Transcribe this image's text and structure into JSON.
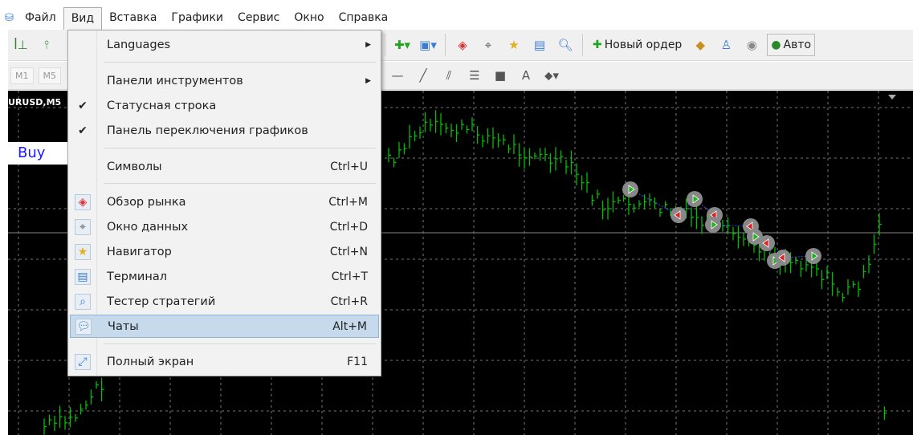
{
  "menubar": {
    "items": [
      "Файл",
      "Вид",
      "Вставка",
      "Графики",
      "Сервис",
      "Окно",
      "Справка"
    ],
    "open": "Вид"
  },
  "toolbar": {
    "new_order": "Новый ордер",
    "auto": "Авто",
    "timeframes": [
      "M1",
      "M5"
    ]
  },
  "chart": {
    "symbol": "URUSD,M5",
    "buy_label": "Buy"
  },
  "view_menu": {
    "items": [
      {
        "label": "Languages",
        "submenu": true
      },
      {
        "label": "Панели инструментов",
        "submenu": true
      },
      {
        "label": "Статусная строка",
        "checked": true
      },
      {
        "label": "Панель переключения графиков",
        "checked": true
      },
      {
        "label": "Символы",
        "shortcut": "Ctrl+U"
      },
      {
        "label": "Обзор рынка",
        "shortcut": "Ctrl+M",
        "icon": "market-watch-icon"
      },
      {
        "label": "Окно данных",
        "shortcut": "Ctrl+D",
        "icon": "crosshair-icon"
      },
      {
        "label": "Навигатор",
        "shortcut": "Ctrl+N",
        "icon": "navigator-folder-star-icon"
      },
      {
        "label": "Терминал",
        "shortcut": "Ctrl+T",
        "icon": "terminal-icon"
      },
      {
        "label": "Тестер стратегий",
        "shortcut": "Ctrl+R",
        "icon": "strategy-tester-icon"
      },
      {
        "label": "Чаты",
        "shortcut": "Alt+M",
        "icon": "chat-icon",
        "highlighted": true
      },
      {
        "label": "Полный экран",
        "shortcut": "F11",
        "icon": "fullscreen-icon"
      }
    ]
  },
  "colors": {
    "chart_bg": "#000000",
    "candle": "#00c000",
    "highlight": "#c6daeb",
    "buy": "#1a1aff"
  }
}
